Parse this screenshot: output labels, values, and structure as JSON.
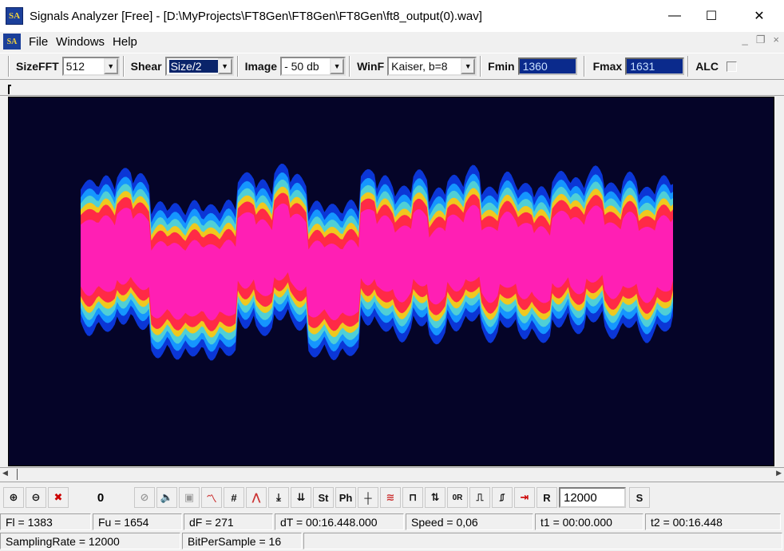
{
  "window": {
    "title": "Signals Analyzer [Free] - [D:\\MyProjects\\FT8Gen\\FT8Gen\\FT8Gen\\ft8_output(0).wav]",
    "app_icon_text": "SA",
    "minimize": "—",
    "maximize": "☐",
    "close": "✕"
  },
  "menu": {
    "items": [
      "File",
      "Windows",
      "Help"
    ],
    "mdi_minimize": "_",
    "mdi_restore": "❐",
    "mdi_close": "×"
  },
  "toolbar": {
    "sizefft_label": "SizeFFT",
    "sizefft_value": "512",
    "shear_label": "Shear",
    "shear_value": "Size/2",
    "image_label": "Image",
    "image_value": "- 50 db",
    "winf_label": "WinF",
    "winf_value": "Kaiser, b=8",
    "fmin_label": "Fmin",
    "fmin_value": "1360",
    "fmax_label": "Fmax",
    "fmax_value": "1631",
    "alc_label": "ALC"
  },
  "colors": {
    "plot_background": "#050428",
    "spectrum_levels": [
      "#0b36d6",
      "#1596ff",
      "#4fcfd6",
      "#f0c81e",
      "#ff2a46",
      "#ff1fb4"
    ]
  },
  "bottom_toolbar": {
    "icons": [
      "zoom-in-icon",
      "zoom-out-icon",
      "delete-icon"
    ],
    "counter": "0",
    "tool_icons": [
      "cancel-icon",
      "speaker-icon",
      "stop-icon",
      "chart-icon",
      "grid-icon",
      "graph-icon",
      "arrow-down-icon",
      "multi-arrow-icon"
    ],
    "st_label": "St",
    "ph_label": "Ph",
    "wave_icons": [
      "impulse-icon",
      "chart2-icon",
      "square-wave-icon",
      "arrows-icon",
      "or-icon",
      "step-icon",
      "pulse-icon",
      "export-icon"
    ],
    "r_label": "R",
    "rate_field": "12000",
    "s_label": "S"
  },
  "status": {
    "fl": "Fl = 1383",
    "fu": "Fu = 1654",
    "df": "dF = 271",
    "dt": "dT = 00:16.448.000",
    "speed": "Speed = 0,06",
    "t1": "t1 = 00:00.000",
    "t2": "t2 = 00:16.448",
    "sampling_rate": "SamplingRate = 12000",
    "bit_per_sample": "BitPerSample = 16"
  }
}
